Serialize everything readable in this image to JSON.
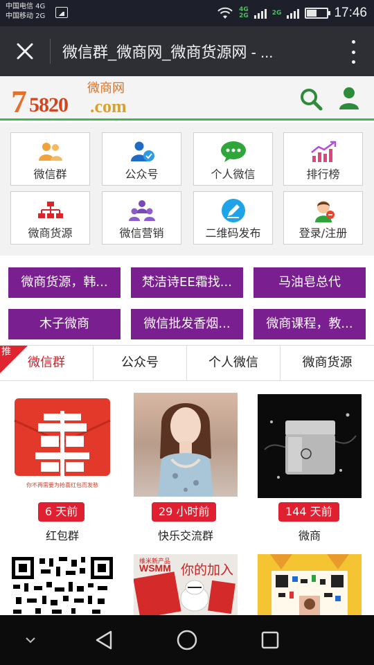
{
  "status_bar": {
    "carrier1": "中国电信 4G",
    "carrier2": "中国移动 2G",
    "net_top": "4G",
    "net_bottom": "2G",
    "net_top2": "2G",
    "time": "17:46"
  },
  "browser": {
    "title": "微信群_微商网_微商货源网 - ..."
  },
  "site": {
    "logo_seven": "7",
    "logo_number": "5820",
    "logo_domain": ".com",
    "logo_cn": "微商网"
  },
  "menu": [
    {
      "label": "微信群",
      "icon": "group-icon"
    },
    {
      "label": "公众号",
      "icon": "official-account-icon"
    },
    {
      "label": "个人微信",
      "icon": "wechat-chat-icon"
    },
    {
      "label": "排行榜",
      "icon": "ranking-chart-icon"
    },
    {
      "label": "微商货源",
      "icon": "org-chart-icon"
    },
    {
      "label": "微信营销",
      "icon": "people-marketing-icon"
    },
    {
      "label": "二维码发布",
      "icon": "qr-publish-icon"
    },
    {
      "label": "登录/注册",
      "icon": "login-user-icon"
    }
  ],
  "tags": [
    "微商货源，韩...",
    "梵洁诗EE霜找...",
    "马油皂总代",
    "木子微商",
    "微信批发香烟...",
    "微商课程，教..."
  ],
  "tabs": {
    "badge": "推",
    "items": [
      "微信群",
      "公众号",
      "个人微信",
      "微商货源"
    ]
  },
  "cards": [
    {
      "time": "6 天前",
      "name": "红包群",
      "image_caption": "你不再需要为抢喜红包而发愁"
    },
    {
      "time": "29 小时前",
      "name": "快乐交流群"
    },
    {
      "time": "144 天前",
      "name": "微商"
    }
  ],
  "second_row": {
    "brand": "WSMM",
    "brand_top": "维米新产品",
    "slogan": "你的加入"
  },
  "colors": {
    "accent_green": "#3db84a",
    "tag_purple": "#7a1f90",
    "badge_red": "#e02030"
  }
}
